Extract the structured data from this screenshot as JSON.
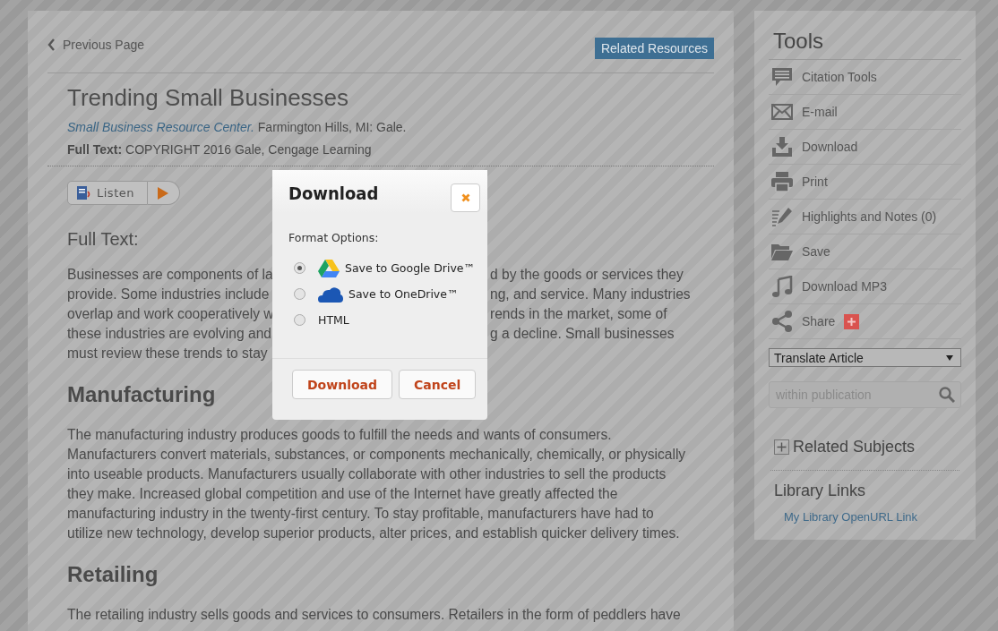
{
  "nav": {
    "back": "Previous Page",
    "related_button": "Related Resources"
  },
  "article": {
    "title": "Trending Small Businesses",
    "publication": "Small Business Resource Center.",
    "publisher": "Farmington Hills, MI: Gale.",
    "rights": "**Full Text:** COPYRIGHT 2016 Gale, Cengage Learning",
    "listen": "Listen"
  },
  "sections": [
    {
      "kind": "subhead",
      "heading": "Full Text:",
      "lines": [
        {
          "left": "Businesses are components of la",
          "right": "d by the goods or services they"
        },
        {
          "left": "provide. Some industries include",
          "right": "ng, and service. Many industries"
        },
        {
          "left": "overlap and work cooperatively w",
          "right": "rends in the market, some of"
        },
        {
          "left": "these industries are evolving and",
          "right": "g a decline. Small businesses"
        },
        {
          "left": "must review these trends to stay"
        }
      ]
    },
    {
      "kind": "section",
      "heading": "Manufacturing",
      "paragraph": "The manufacturing industry produces goods to fulfill the needs and wants of consumers. Manufacturers convert materials, substances, or components mechanically, chemically, or physically into useable products. Manufacturers usually collaborate with other industries to sell the products they make. Increased global competition and use of the Internet have greatly affected the manufacturing industry in the twenty-first century. To stay profitable, manufacturers have had to utilize new technology, develop superior products, alter prices, and establish quicker delivery times."
    },
    {
      "kind": "section",
      "heading": "Retailing",
      "paragraph": "The retailing industry sells goods and services to consumers. Retailers in the form of peddlers have"
    }
  ],
  "tools": {
    "title": "Tools",
    "items": [
      {
        "label": "Citation Tools",
        "addable": false
      },
      {
        "label": "E-mail",
        "addable": false
      },
      {
        "label": "Download",
        "addable": false
      },
      {
        "label": "Print",
        "addable": false
      },
      {
        "label": "Highlights and Notes (0)",
        "addable": false
      },
      {
        "label": "Save",
        "addable": false
      },
      {
        "label": "Download MP3",
        "addable": false
      },
      {
        "label": "Share",
        "addable": true
      }
    ],
    "translate": "Translate Article",
    "search": {
      "placeholder": "within publication"
    },
    "related_subjects": "Related Subjects",
    "library_title": "Library Links",
    "library_link": "My Library OpenURL Link"
  },
  "dialog": {
    "title": "Download",
    "format_label": "Format Options:",
    "options": [
      {
        "label": "Save to Google Drive™",
        "kind": "gdrive",
        "selected": true
      },
      {
        "label": "Save to OneDrive™",
        "kind": "onedrive",
        "selected": false
      },
      {
        "label": "HTML",
        "kind": "plain",
        "selected": false
      }
    ],
    "buttons": [
      "Download",
      "Cancel"
    ]
  }
}
